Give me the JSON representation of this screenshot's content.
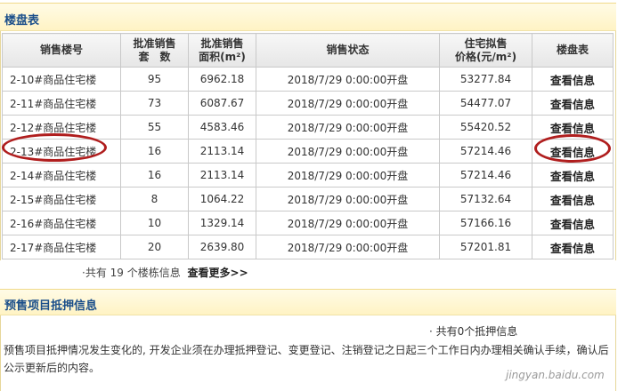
{
  "project_table": {
    "title": "楼盘表",
    "headers": {
      "col1": "销售楼号",
      "col2_line1": "批准销售",
      "col2_line2": "套　数",
      "col3_line1": "批准销售",
      "col3_line2": "面积(m²)",
      "col4": "销售状态",
      "col5_line1": "住宅拟售",
      "col5_line2": "价格(元/m²)",
      "col6": "楼盘表"
    },
    "rows": [
      {
        "name": "2-10#商品住宅楼",
        "units": "95",
        "area": "6962.18",
        "status": "2018/7/29 0:00:00开盘",
        "price": "53277.84",
        "link": "查看信息"
      },
      {
        "name": "2-11#商品住宅楼",
        "units": "73",
        "area": "6087.67",
        "status": "2018/7/29 0:00:00开盘",
        "price": "54477.07",
        "link": "查看信息"
      },
      {
        "name": "2-12#商品住宅楼",
        "units": "55",
        "area": "4583.46",
        "status": "2018/7/29 0:00:00开盘",
        "price": "55420.52",
        "link": "查看信息"
      },
      {
        "name": "2-13#商品住宅楼",
        "units": "16",
        "area": "2113.14",
        "status": "2018/7/29 0:00:00开盘",
        "price": "57214.46",
        "link": "查看信息"
      },
      {
        "name": "2-14#商品住宅楼",
        "units": "16",
        "area": "2113.14",
        "status": "2018/7/29 0:00:00开盘",
        "price": "57214.46",
        "link": "查看信息"
      },
      {
        "name": "2-15#商品住宅楼",
        "units": "8",
        "area": "1064.22",
        "status": "2018/7/29 0:00:00开盘",
        "price": "57132.64",
        "link": "查看信息"
      },
      {
        "name": "2-16#商品住宅楼",
        "units": "10",
        "area": "1329.14",
        "status": "2018/7/29 0:00:00开盘",
        "price": "57166.16",
        "link": "查看信息"
      },
      {
        "name": "2-17#商品住宅楼",
        "units": "20",
        "area": "2639.80",
        "status": "2018/7/29 0:00:00开盘",
        "price": "57201.81",
        "link": "查看信息"
      }
    ],
    "footnote": "·共有 19 个楼栋信息",
    "more_link": "查看更多>>"
  },
  "mortgage": {
    "title": "预售项目抵押信息",
    "count_text": "· 共有0个抵押信息",
    "description": "预售项目抵押情况发生变化的, 开发企业须在办理抵押登记、变更登记、注销登记之日起三个工作日内办理相关确认手续，确认后公示更新后的内容。"
  },
  "watermark": "jingyan.baidu.com",
  "annotation_color": "#b01e1e"
}
